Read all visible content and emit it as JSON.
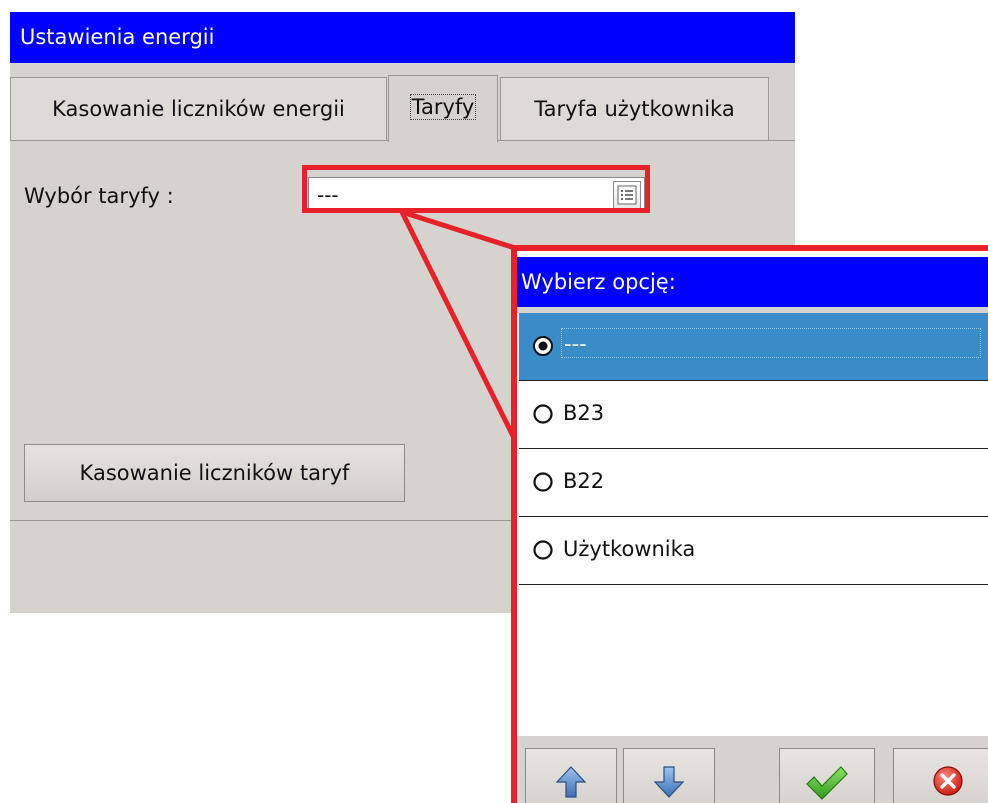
{
  "window": {
    "title": "Ustawienia energii"
  },
  "tabs": [
    {
      "label": "Kasowanie liczników energii",
      "active": false
    },
    {
      "label": "Taryfy",
      "active": true
    },
    {
      "label": "Taryfa użytkownika",
      "active": false
    }
  ],
  "form": {
    "tariff_label": "Wybór taryfy :",
    "tariff_value": "---",
    "reset_button": "Kasowanie liczników taryf"
  },
  "popup": {
    "title": "Wybierz opcję:",
    "options": [
      {
        "label": "---",
        "selected": true
      },
      {
        "label": "B23",
        "selected": false
      },
      {
        "label": "B22",
        "selected": false
      },
      {
        "label": "Użytkownika",
        "selected": false
      }
    ],
    "toolbar": [
      "arrow-up-icon",
      "arrow-down-icon",
      "check-icon",
      "cancel-icon"
    ]
  },
  "colors": {
    "titlebar": "#0000ff",
    "window_bg": "#d6d3ce",
    "selection": "#3a8cc8",
    "callout": "#e8202a"
  }
}
